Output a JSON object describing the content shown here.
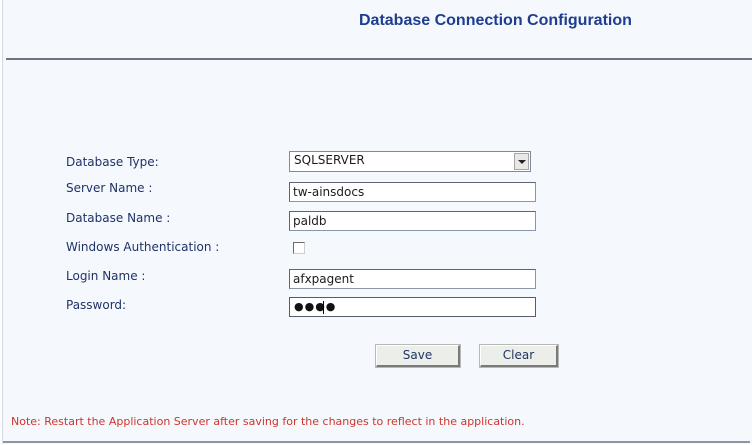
{
  "header": {
    "title": "Database Connection Configuration"
  },
  "form": {
    "database_type": {
      "label": "Database Type:",
      "value": "SQLSERVER"
    },
    "server_name": {
      "label": "Server Name :",
      "value": "tw-ainsdocs"
    },
    "database_name": {
      "label": "Database Name :",
      "value": "paldb"
    },
    "windows_auth": {
      "label": "Windows Authentication :",
      "checked": false
    },
    "login_name": {
      "label": "Login Name :",
      "value": "afxpagent"
    },
    "password": {
      "label": "Password:",
      "masked": "●●●●"
    }
  },
  "buttons": {
    "save_label": "Save",
    "clear_label": "Clear"
  },
  "footer": {
    "note": "Note: Restart the Application Server after saving for the changes to reflect in the application."
  },
  "colors": {
    "title": "#1f3d8f",
    "label": "#1f3367",
    "note": "#d0342c",
    "background": "#f5f8fc"
  }
}
